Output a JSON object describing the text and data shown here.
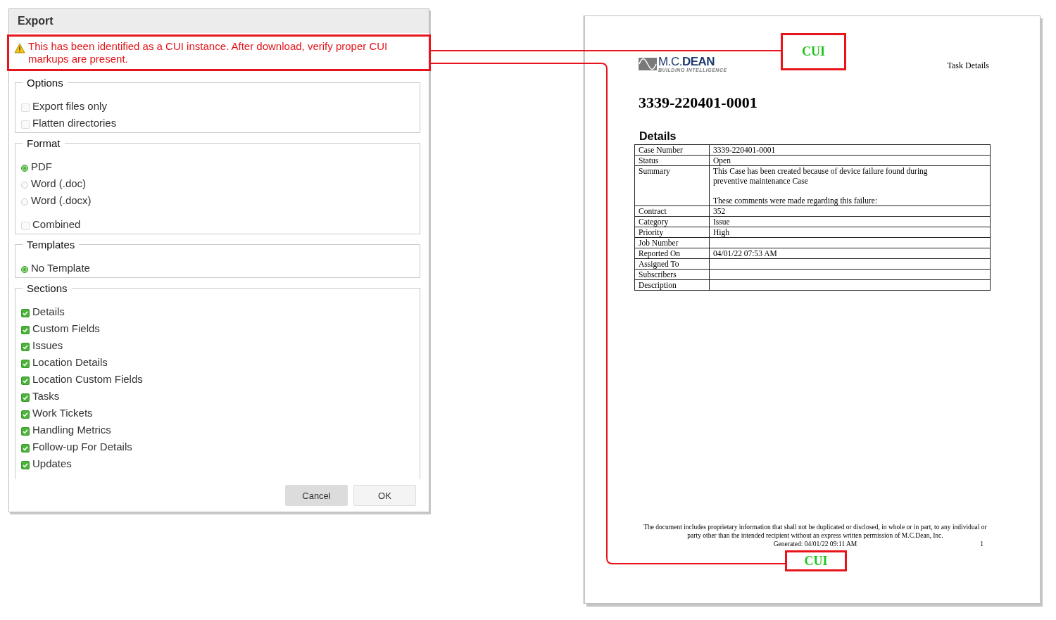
{
  "dialog": {
    "title": "Export",
    "warning": "This has been identified as a CUI instance. After download, verify proper CUI markups are present.",
    "groups": [
      {
        "legend": "Options",
        "items": [
          {
            "kind": "checkbox",
            "label": "Export files only",
            "checked": false
          },
          {
            "kind": "checkbox",
            "label": "Flatten directories",
            "checked": false
          }
        ]
      },
      {
        "legend": "Format",
        "items": [
          {
            "kind": "radio",
            "label": "PDF",
            "selected": true
          },
          {
            "kind": "radio",
            "label": "Word (.doc)",
            "selected": false
          },
          {
            "kind": "radio",
            "label": "Word (.docx)",
            "selected": false
          },
          {
            "kind": "gap"
          },
          {
            "kind": "checkbox",
            "label": "Combined",
            "checked": false
          }
        ]
      },
      {
        "legend": "Templates",
        "items": [
          {
            "kind": "radio",
            "label": "No Template",
            "selected": true
          }
        ]
      },
      {
        "legend": "Sections",
        "items": [
          {
            "kind": "checkbox",
            "label": "Details",
            "checked": true
          },
          {
            "kind": "checkbox",
            "label": "Custom Fields",
            "checked": true
          },
          {
            "kind": "checkbox",
            "label": "Issues",
            "checked": true
          },
          {
            "kind": "checkbox",
            "label": "Location Details",
            "checked": true
          },
          {
            "kind": "checkbox",
            "label": "Location Custom Fields",
            "checked": true
          },
          {
            "kind": "checkbox",
            "label": "Tasks",
            "checked": true
          },
          {
            "kind": "checkbox",
            "label": "Work Tickets",
            "checked": true
          },
          {
            "kind": "checkbox",
            "label": "Handling Metrics",
            "checked": true
          },
          {
            "kind": "checkbox",
            "label": "Follow-up For Details",
            "checked": true
          },
          {
            "kind": "checkbox",
            "label": "Updates",
            "checked": true
          }
        ]
      }
    ],
    "buttons": [
      {
        "label": "Cancel",
        "kind": "secondary"
      },
      {
        "label": "OK",
        "kind": "default"
      }
    ]
  },
  "document": {
    "logo": {
      "prefix": "M.C.",
      "name": "DEAN",
      "tagline": "BUILDING INTELLIGENCE"
    },
    "header_label": "Task Details",
    "title": "3339-220401-0001",
    "section_heading": "Details",
    "rows": [
      {
        "label": "Case Number",
        "value": "3339-220401-0001"
      },
      {
        "label": "Status",
        "value": "Open"
      },
      {
        "label": "Summary",
        "value": "This Case has been created because of device failure found during\npreventive maintenance Case\n\nThese comments were made regarding this failure:"
      },
      {
        "label": "Contract",
        "value": "352"
      },
      {
        "label": "Category",
        "value": "Issue"
      },
      {
        "label": "Priority",
        "value": "High"
      },
      {
        "label": "Job Number",
        "value": ""
      },
      {
        "label": "Reported On",
        "value": "04/01/22 07:53 AM"
      },
      {
        "label": "Assigned To",
        "value": ""
      },
      {
        "label": "Subscribers",
        "value": ""
      },
      {
        "label": "Description",
        "value": ""
      }
    ],
    "footer_notice": "The document includes proprietary information that shall not be duplicated or disclosed, in whole or in part, to any individual or party other than the intended recipient without an express written permission of M.C.Dean, Inc.",
    "generated": "Generated: 04/01/22 09:11 AM",
    "page_number": "1"
  },
  "cui_marks": [
    {
      "label": "CUI"
    },
    {
      "label": "CUI"
    }
  ]
}
